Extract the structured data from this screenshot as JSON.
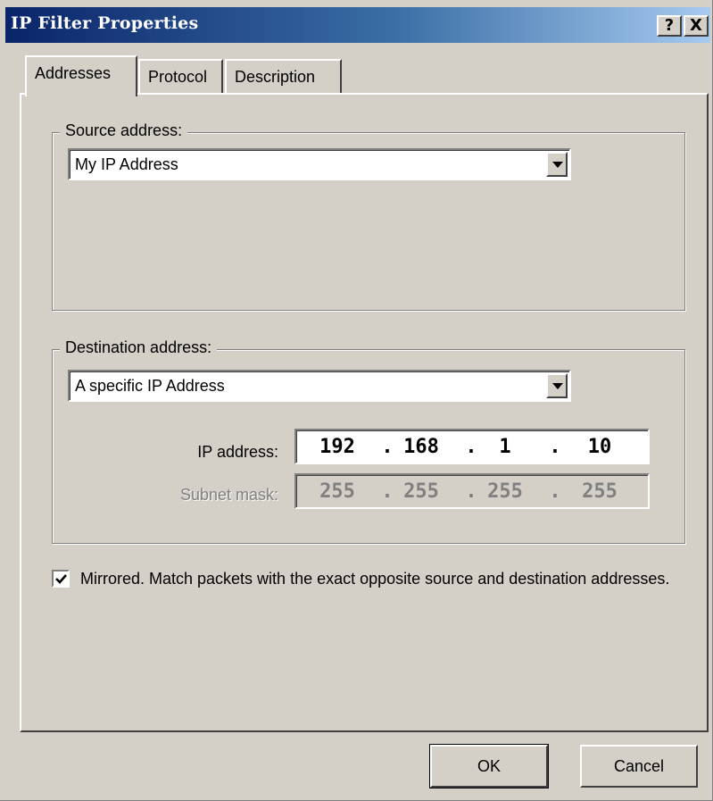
{
  "window": {
    "title": "IP Filter Properties",
    "help_label": "?",
    "close_label": "X"
  },
  "tabs": [
    {
      "label": "Addresses",
      "active": true
    },
    {
      "label": "Protocol",
      "active": false
    },
    {
      "label": "Description",
      "active": false
    }
  ],
  "source": {
    "group_label": "Source address:",
    "selected": "My IP Address"
  },
  "destination": {
    "group_label": "Destination address:",
    "selected": "A specific IP Address",
    "ip_label": "IP address:",
    "ip_octets": [
      "192",
      "168",
      "1",
      "10"
    ],
    "mask_label": "Subnet mask:",
    "mask_octets": [
      "255",
      "255",
      "255",
      "255"
    ],
    "dot": "."
  },
  "mirrored": {
    "checked": true,
    "label": "Mirrored. Match packets with the exact opposite source and destination addresses."
  },
  "buttons": {
    "ok": "OK",
    "cancel": "Cancel"
  },
  "icons": {
    "dropdown": "chevron-down-icon",
    "check": "checkmark-icon"
  },
  "colors": {
    "face": "#d4d0c8",
    "title_start": "#0a246a",
    "title_end": "#a6caf0",
    "disabled_text": "#808080"
  }
}
